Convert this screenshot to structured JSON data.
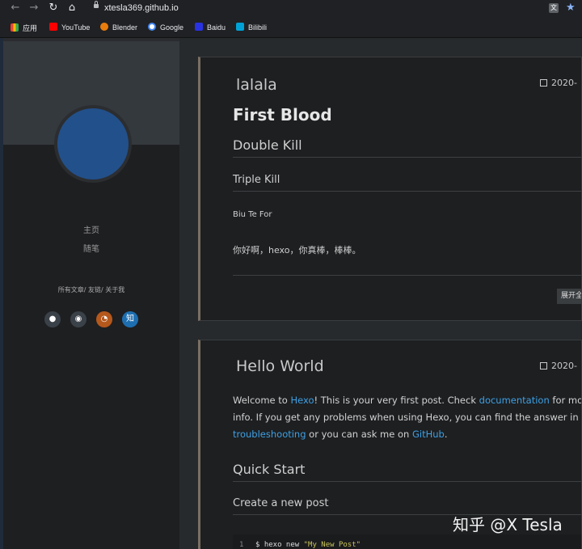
{
  "browser": {
    "url": "xtesla369.github.io",
    "bookmarks": [
      {
        "label": "应用",
        "icon": "apps-grid-icon",
        "color": "#ea4335"
      },
      {
        "label": "YouTube",
        "icon": "youtube-icon",
        "color": "#ff0000"
      },
      {
        "label": "Blender",
        "icon": "blender-icon",
        "color": "#e87d0d"
      },
      {
        "label": "Google",
        "icon": "google-icon",
        "color": "#4285f4"
      },
      {
        "label": "Baidu",
        "icon": "baidu-icon",
        "color": "#2932e1"
      },
      {
        "label": "Bilibili",
        "icon": "bilibili-icon",
        "color": "#00a1d6"
      }
    ]
  },
  "sidebar": {
    "menu": [
      "主页",
      "随笔"
    ],
    "links": "所有文章/ 友链/ 关于我",
    "social": [
      {
        "icon": "github-icon",
        "color": "#3b4148"
      },
      {
        "icon": "weibo-icon",
        "color": "#3b4148"
      },
      {
        "icon": "rss-icon",
        "color": "#b5581c"
      },
      {
        "icon": "zhihu-icon",
        "color": "#1e6fb0",
        "label": "知"
      }
    ]
  },
  "posts": [
    {
      "title": "lalala",
      "date": "2020-",
      "h1": "First Blood",
      "h2": "Double Kill",
      "h3": "Triple Kill",
      "p1": "Biu Te For",
      "p2": "你好啊，hexo，你真棒，棒棒。",
      "read_more": "展开全"
    },
    {
      "title": "Hello World",
      "date": "2020-",
      "intro": {
        "t1": "Welcome to ",
        "l1": "Hexo",
        "t2": "! This is your very first post. Check ",
        "l2": "documentation",
        "t3": " for mor info. If you get any problems when using Hexo, you can find the answer in ",
        "l3": "troubleshooting",
        "t4": " or you can ask me on ",
        "l4": "GitHub",
        "t5": "."
      },
      "h2": "Quick Start",
      "h3": "Create a new post",
      "code": {
        "line": "1",
        "cmd": "$ hexo new ",
        "arg": "\"My New Post\""
      }
    }
  ],
  "watermark": "知乎 @X Tesla"
}
